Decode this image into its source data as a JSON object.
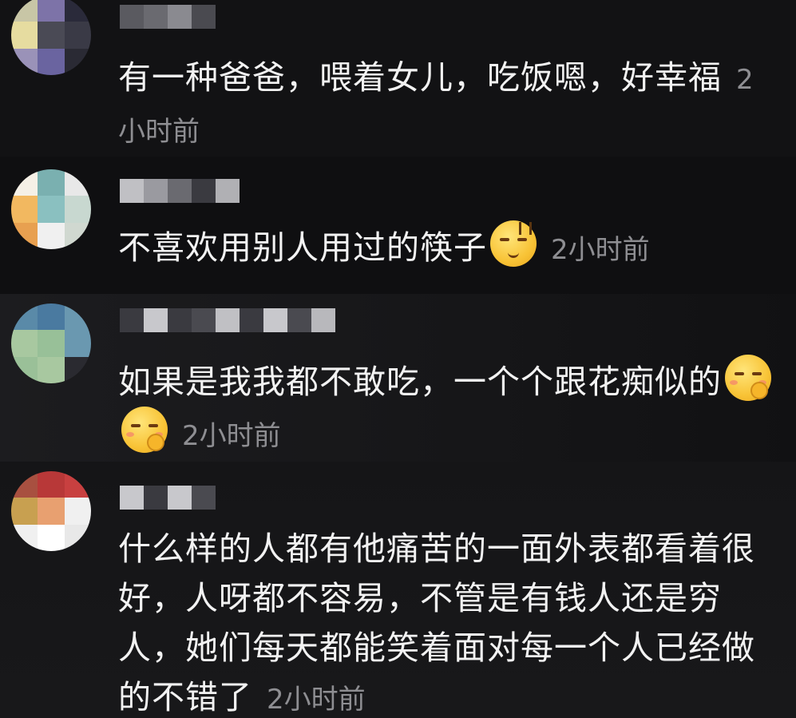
{
  "comments": [
    {
      "text": "有一种爸爸，喂着女儿，吃饭嗯，好幸福",
      "time": "2小时前",
      "emojis": []
    },
    {
      "text": "不喜欢用别人用过的筷子",
      "time": "2小时前",
      "emojis": [
        "smirk-emoji"
      ]
    },
    {
      "text": "如果是我我都不敢吃，一个个跟花痴似的",
      "time": "2小时前",
      "emojis": [
        "shush-emoji",
        "shush-emoji"
      ]
    },
    {
      "text": "什么样的人都有他痛苦的一面外表都看着很好，人呀都不容易，不管是有钱人还是穷人，她们每天都能笑着面对每一个人已经做的不错了",
      "time": "2小时前",
      "emojis": []
    }
  ],
  "avatars": [
    {
      "colors": [
        "#c8c6a6",
        "#7d73a8",
        "#2a2a3a",
        "#e6dca0",
        "#4a4a55",
        "#3a3a46",
        "#9a92b8",
        "#6a64a0",
        "#2a2a34"
      ]
    },
    {
      "colors": [
        "#f5f0e6",
        "#7ab0b0",
        "#e8e8e8",
        "#f2b860",
        "#8ac0c0",
        "#c8d8d0",
        "#e8a050",
        "#f0f0f0",
        "#d0d8d0"
      ]
    },
    {
      "colors": [
        "#5a8aa8",
        "#4a7aa0",
        "#6a98b0",
        "#a8c8a0",
        "#98c098",
        "#6a98b0",
        "#9ac098",
        "#a8c8a0",
        "#2a2a30"
      ]
    },
    {
      "colors": [
        "#a85040",
        "#b83838",
        "#c84040",
        "#c8a050",
        "#e8a070",
        "#f0f0f0",
        "#f0f0f0",
        "#ffffff",
        "#e8e8e8"
      ]
    }
  ],
  "names": [
    {
      "colors": [
        "#5a5a60",
        "#6a6a70",
        "#8a8a90",
        "#4a4a50"
      ]
    },
    {
      "colors": [
        "#c0c0c4",
        "#9a9aa0",
        "#6a6a70",
        "#3a3a40",
        "#b0b0b4"
      ]
    },
    {
      "colors": [
        "#3a3a40",
        "#c8c8cc",
        "#3a3a40",
        "#4a4a50",
        "#c0c0c4",
        "#3a3a40",
        "#c8c8cc",
        "#4a4a50",
        "#b8b8bc"
      ]
    },
    {
      "colors": [
        "#c8c8cc",
        "#3a3a40",
        "#c8c8cc",
        "#4a4a50"
      ]
    }
  ]
}
